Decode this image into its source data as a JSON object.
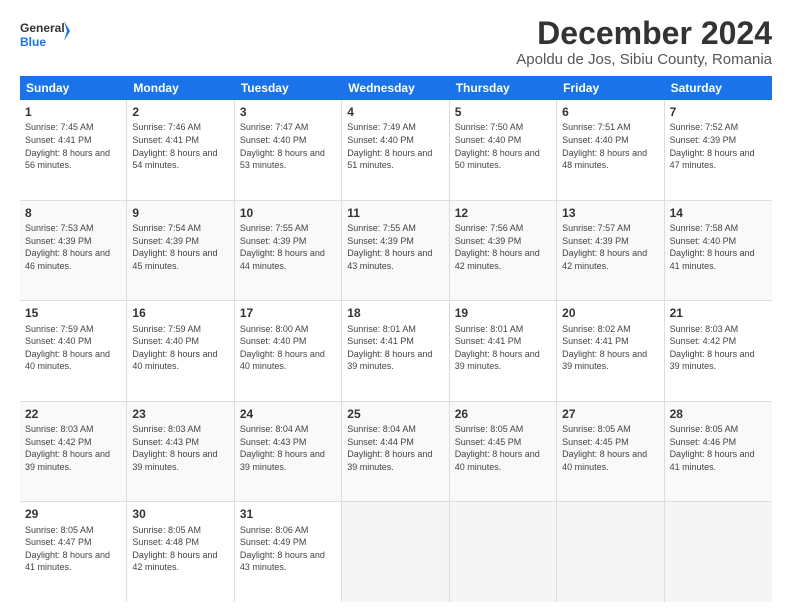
{
  "logo": {
    "line1": "General",
    "line2": "Blue"
  },
  "title": "December 2024",
  "subtitle": "Apoldu de Jos, Sibiu County, Romania",
  "days": [
    "Sunday",
    "Monday",
    "Tuesday",
    "Wednesday",
    "Thursday",
    "Friday",
    "Saturday"
  ],
  "weeks": [
    [
      {
        "day": "1",
        "sunrise": "7:45 AM",
        "sunset": "4:41 PM",
        "daylight": "8 hours and 56 minutes."
      },
      {
        "day": "2",
        "sunrise": "7:46 AM",
        "sunset": "4:41 PM",
        "daylight": "8 hours and 54 minutes."
      },
      {
        "day": "3",
        "sunrise": "7:47 AM",
        "sunset": "4:40 PM",
        "daylight": "8 hours and 53 minutes."
      },
      {
        "day": "4",
        "sunrise": "7:49 AM",
        "sunset": "4:40 PM",
        "daylight": "8 hours and 51 minutes."
      },
      {
        "day": "5",
        "sunrise": "7:50 AM",
        "sunset": "4:40 PM",
        "daylight": "8 hours and 50 minutes."
      },
      {
        "day": "6",
        "sunrise": "7:51 AM",
        "sunset": "4:40 PM",
        "daylight": "8 hours and 48 minutes."
      },
      {
        "day": "7",
        "sunrise": "7:52 AM",
        "sunset": "4:39 PM",
        "daylight": "8 hours and 47 minutes."
      }
    ],
    [
      {
        "day": "8",
        "sunrise": "7:53 AM",
        "sunset": "4:39 PM",
        "daylight": "8 hours and 46 minutes."
      },
      {
        "day": "9",
        "sunrise": "7:54 AM",
        "sunset": "4:39 PM",
        "daylight": "8 hours and 45 minutes."
      },
      {
        "day": "10",
        "sunrise": "7:55 AM",
        "sunset": "4:39 PM",
        "daylight": "8 hours and 44 minutes."
      },
      {
        "day": "11",
        "sunrise": "7:55 AM",
        "sunset": "4:39 PM",
        "daylight": "8 hours and 43 minutes."
      },
      {
        "day": "12",
        "sunrise": "7:56 AM",
        "sunset": "4:39 PM",
        "daylight": "8 hours and 42 minutes."
      },
      {
        "day": "13",
        "sunrise": "7:57 AM",
        "sunset": "4:39 PM",
        "daylight": "8 hours and 42 minutes."
      },
      {
        "day": "14",
        "sunrise": "7:58 AM",
        "sunset": "4:40 PM",
        "daylight": "8 hours and 41 minutes."
      }
    ],
    [
      {
        "day": "15",
        "sunrise": "7:59 AM",
        "sunset": "4:40 PM",
        "daylight": "8 hours and 40 minutes."
      },
      {
        "day": "16",
        "sunrise": "7:59 AM",
        "sunset": "4:40 PM",
        "daylight": "8 hours and 40 minutes."
      },
      {
        "day": "17",
        "sunrise": "8:00 AM",
        "sunset": "4:40 PM",
        "daylight": "8 hours and 40 minutes."
      },
      {
        "day": "18",
        "sunrise": "8:01 AM",
        "sunset": "4:41 PM",
        "daylight": "8 hours and 39 minutes."
      },
      {
        "day": "19",
        "sunrise": "8:01 AM",
        "sunset": "4:41 PM",
        "daylight": "8 hours and 39 minutes."
      },
      {
        "day": "20",
        "sunrise": "8:02 AM",
        "sunset": "4:41 PM",
        "daylight": "8 hours and 39 minutes."
      },
      {
        "day": "21",
        "sunrise": "8:03 AM",
        "sunset": "4:42 PM",
        "daylight": "8 hours and 39 minutes."
      }
    ],
    [
      {
        "day": "22",
        "sunrise": "8:03 AM",
        "sunset": "4:42 PM",
        "daylight": "8 hours and 39 minutes."
      },
      {
        "day": "23",
        "sunrise": "8:03 AM",
        "sunset": "4:43 PM",
        "daylight": "8 hours and 39 minutes."
      },
      {
        "day": "24",
        "sunrise": "8:04 AM",
        "sunset": "4:43 PM",
        "daylight": "8 hours and 39 minutes."
      },
      {
        "day": "25",
        "sunrise": "8:04 AM",
        "sunset": "4:44 PM",
        "daylight": "8 hours and 39 minutes."
      },
      {
        "day": "26",
        "sunrise": "8:05 AM",
        "sunset": "4:45 PM",
        "daylight": "8 hours and 40 minutes."
      },
      {
        "day": "27",
        "sunrise": "8:05 AM",
        "sunset": "4:45 PM",
        "daylight": "8 hours and 40 minutes."
      },
      {
        "day": "28",
        "sunrise": "8:05 AM",
        "sunset": "4:46 PM",
        "daylight": "8 hours and 41 minutes."
      }
    ],
    [
      {
        "day": "29",
        "sunrise": "8:05 AM",
        "sunset": "4:47 PM",
        "daylight": "8 hours and 41 minutes."
      },
      {
        "day": "30",
        "sunrise": "8:05 AM",
        "sunset": "4:48 PM",
        "daylight": "8 hours and 42 minutes."
      },
      {
        "day": "31",
        "sunrise": "8:06 AM",
        "sunset": "4:49 PM",
        "daylight": "8 hours and 43 minutes."
      },
      null,
      null,
      null,
      null
    ]
  ]
}
